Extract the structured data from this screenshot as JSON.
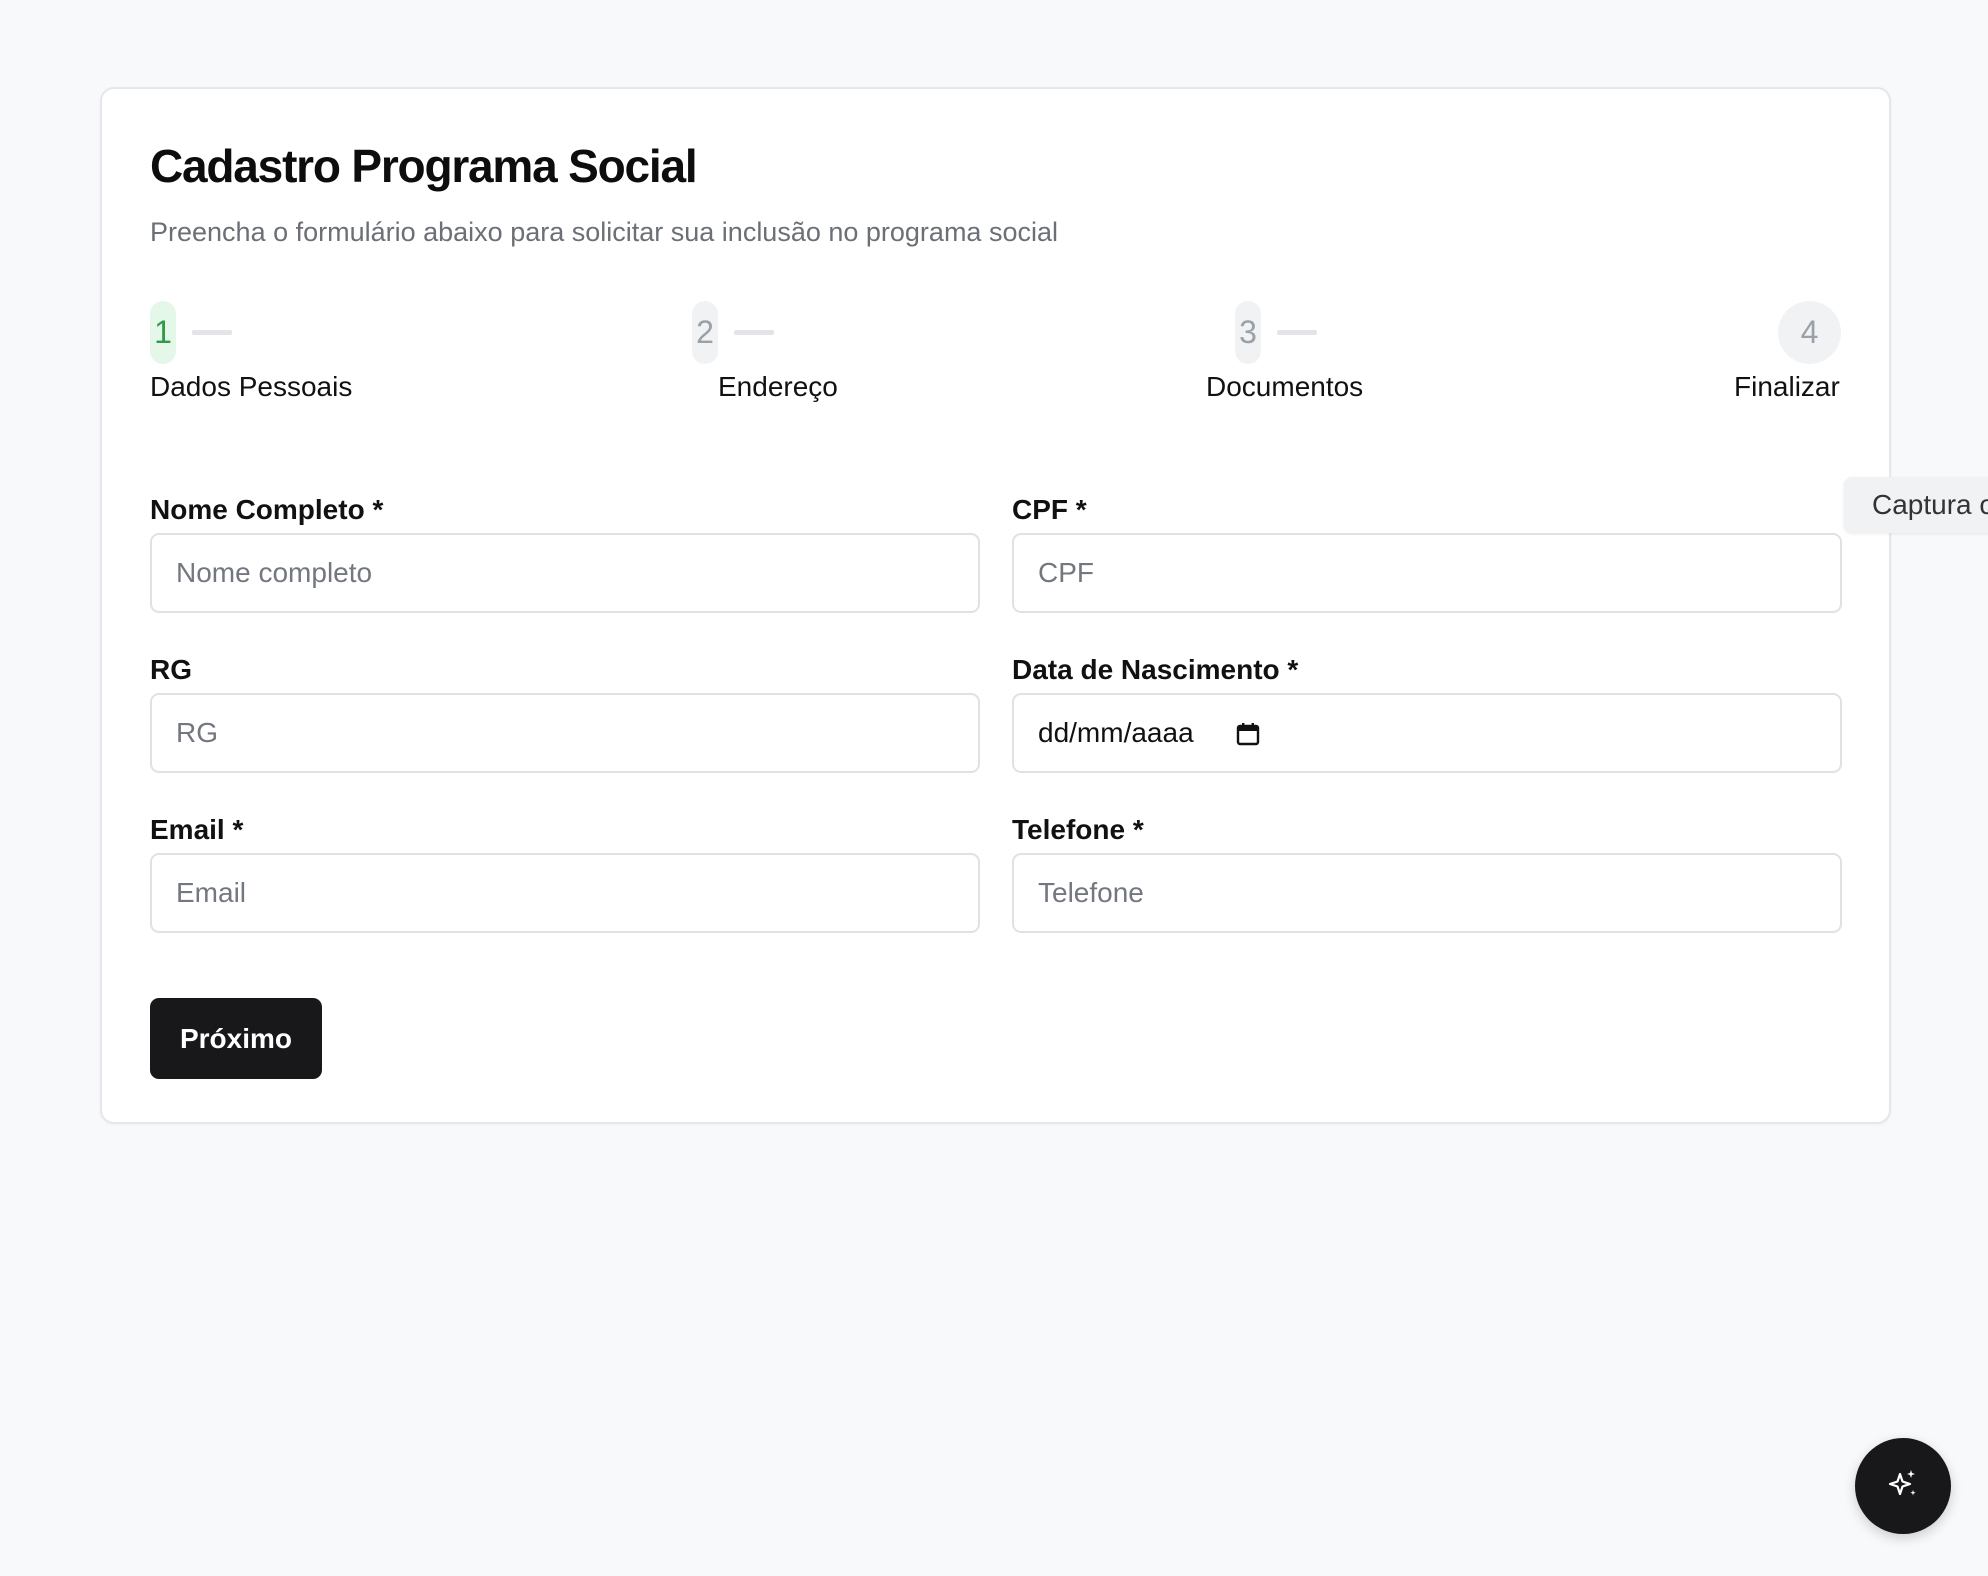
{
  "header": {
    "title": "Cadastro Programa Social",
    "subtitle": "Preencha o formulário abaixo para solicitar sua inclusão no programa social"
  },
  "stepper": {
    "current_step": 1,
    "steps": [
      {
        "number": "1",
        "label": "Dados Pessoais"
      },
      {
        "number": "2",
        "label": "Endereço"
      },
      {
        "number": "3",
        "label": "Documentos"
      },
      {
        "number": "4",
        "label": "Finalizar"
      }
    ]
  },
  "form": {
    "nome": {
      "label": "Nome Completo *",
      "placeholder": "Nome completo",
      "value": ""
    },
    "cpf": {
      "label": "CPF *",
      "placeholder": "CPF",
      "value": ""
    },
    "rg": {
      "label": "RG",
      "placeholder": "RG",
      "value": ""
    },
    "nascimento": {
      "label": "Data de Nascimento *",
      "value": "dd/mm/aaaa"
    },
    "email": {
      "label": "Email *",
      "placeholder": "Email",
      "value": ""
    },
    "telefone": {
      "label": "Telefone *",
      "placeholder": "Telefone",
      "value": ""
    }
  },
  "actions": {
    "next_label": "Próximo"
  },
  "side_tab": {
    "label": "Captura c"
  },
  "colors": {
    "accent_active_bg": "#e5f7e9",
    "accent_active_text": "#2e9b48",
    "button_dark": "#18181b"
  },
  "icons": {
    "calendar": "calendar-icon",
    "fab": "sparkles-icon"
  }
}
